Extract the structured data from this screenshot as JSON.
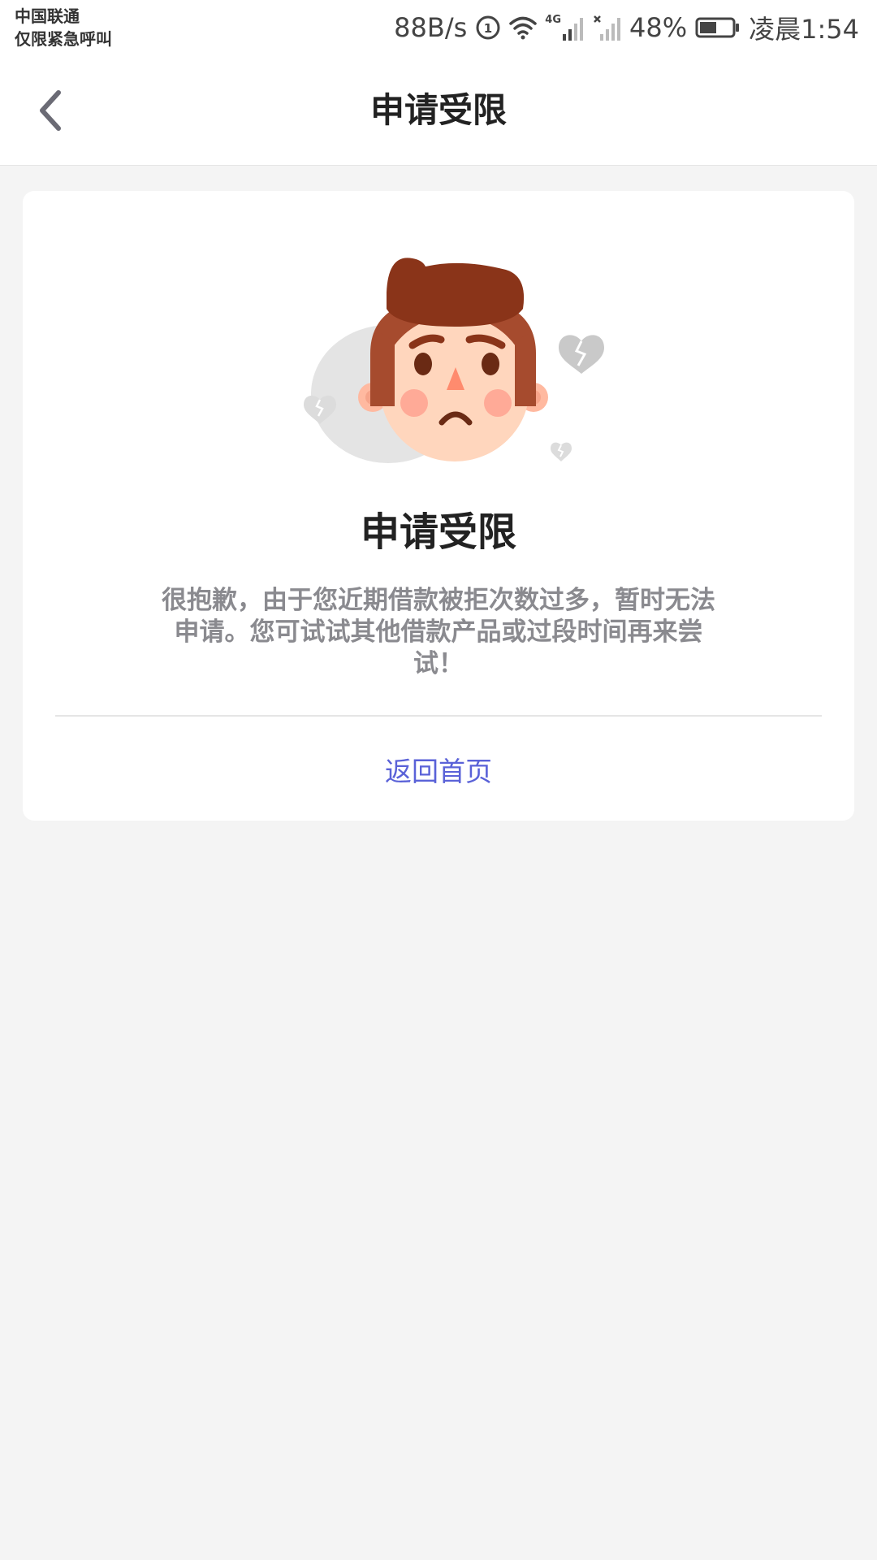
{
  "status_bar": {
    "carrier_line1": "中国联通",
    "carrier_line2": "仅限紧急呼叫",
    "network_speed": "88B/s",
    "network_type": "4G",
    "battery": "48%",
    "time": "凌晨1:54"
  },
  "nav": {
    "title": "申请受限",
    "back_icon": "chevron-left-icon"
  },
  "card": {
    "illustration": "sad-face-broken-hearts",
    "title": "申请受限",
    "message": "很抱歉，由于您近期借款被拒次数过多，暂时无法申请。您可试试其他借款产品或过段时间再来尝试！",
    "home_link": "返回首页"
  },
  "colors": {
    "background": "#f4f4f4",
    "card": "#ffffff",
    "link": "#5a62d8",
    "message_text": "#8a8a8f",
    "title_text": "#222222"
  }
}
